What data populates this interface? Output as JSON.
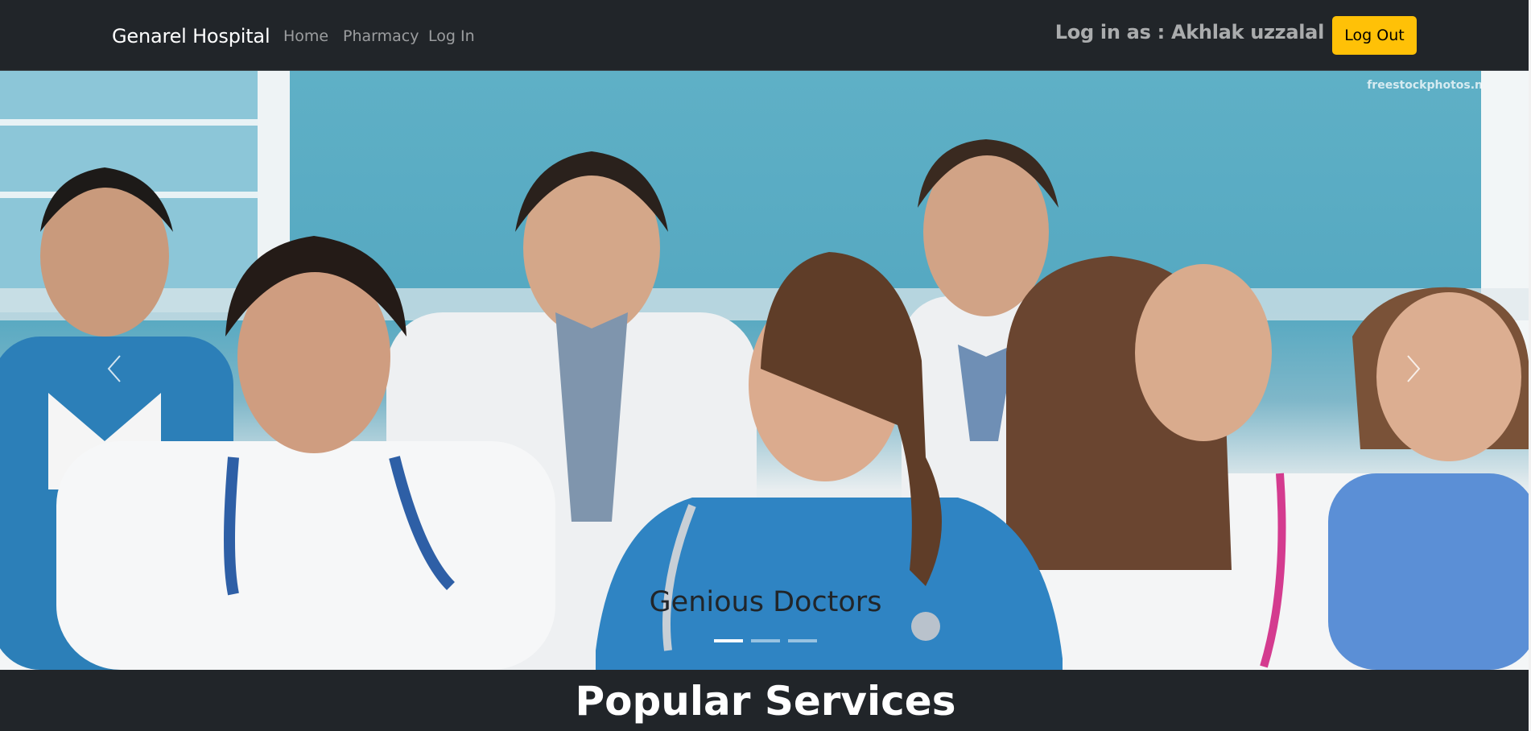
{
  "navbar": {
    "brand": "Genarel Hospital",
    "links": [
      {
        "label": "Home"
      },
      {
        "label": "Pharmacy"
      },
      {
        "label": "Log In"
      }
    ],
    "login_status": "Log in as : Akhlak uzzalal",
    "logout_label": "Log Out",
    "accent_color": "#ffc107",
    "background_color": "#212529"
  },
  "carousel": {
    "image_watermark": "freestockphotos.n",
    "caption": "Genious Doctors",
    "slide_count": 3,
    "active_slide": 1,
    "prev_icon": "chevron-left-icon",
    "next_icon": "chevron-right-icon"
  },
  "section": {
    "title": "Popular Services"
  }
}
